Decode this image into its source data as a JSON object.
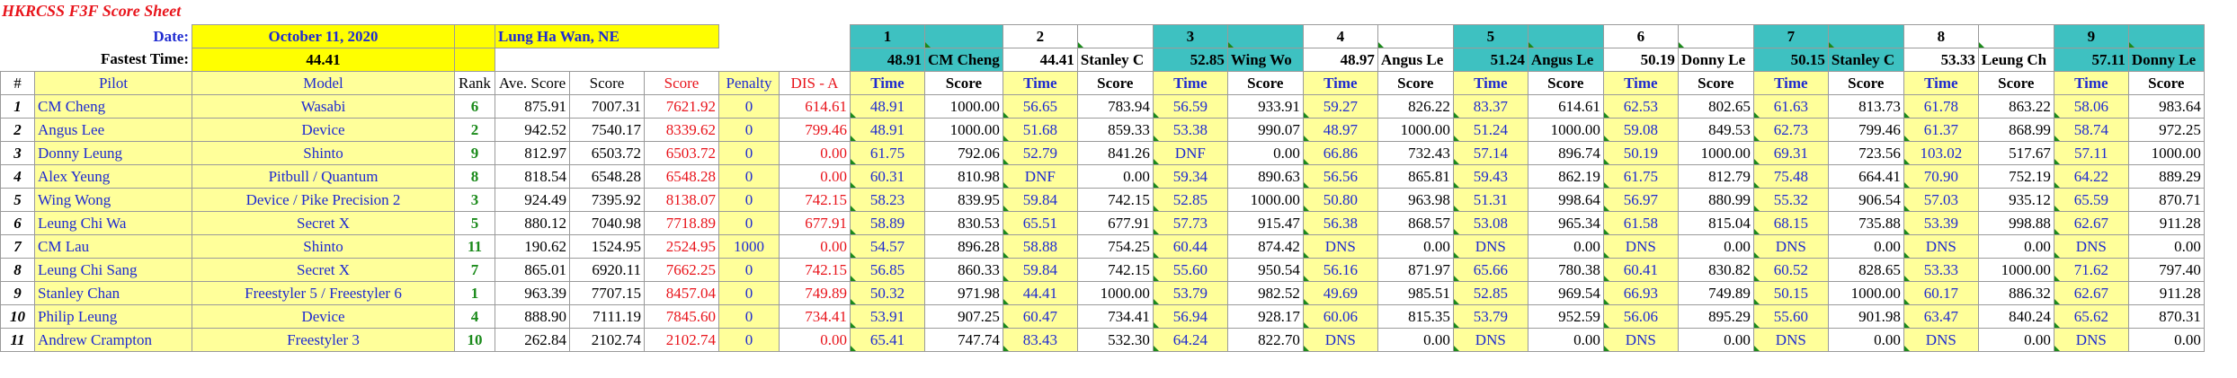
{
  "title": "HKRCSS F3F Score Sheet",
  "date_label": "Date:",
  "date_value": "October 11, 2020",
  "location": "Lung Ha Wan, NE",
  "fastest_label": "Fastest Time:",
  "fastest_value": "44.41",
  "rounds": [
    {
      "num": "1",
      "best_time": "48.91",
      "best_pilot": "CM Cheng"
    },
    {
      "num": "2",
      "best_time": "44.41",
      "best_pilot": "Stanley C"
    },
    {
      "num": "3",
      "best_time": "52.85",
      "best_pilot": "Wing Wo"
    },
    {
      "num": "4",
      "best_time": "48.97",
      "best_pilot": "Angus Le"
    },
    {
      "num": "5",
      "best_time": "51.24",
      "best_pilot": "Angus Le"
    },
    {
      "num": "6",
      "best_time": "50.19",
      "best_pilot": "Donny Le"
    },
    {
      "num": "7",
      "best_time": "50.15",
      "best_pilot": "Stanley C"
    },
    {
      "num": "8",
      "best_time": "53.33",
      "best_pilot": "Leung Ch"
    },
    {
      "num": "9",
      "best_time": "57.11",
      "best_pilot": "Donny Le"
    }
  ],
  "headers": {
    "num": "#",
    "pilot": "Pilot",
    "model": "Model",
    "rank": "Rank",
    "ave": "Ave. Score",
    "score": "Score",
    "score2": "Score",
    "penalty": "Penalty",
    "dis": "DIS - A",
    "time": "Time",
    "round_score": "Score"
  },
  "pilots": [
    {
      "n": "1",
      "pilot": "CM Cheng",
      "model": "Wasabi",
      "rank": "6",
      "ave": "875.91",
      "score": "7007.31",
      "score2": "7621.92",
      "penalty": "0",
      "dis": "614.61",
      "rounds": [
        [
          "48.91",
          "1000.00"
        ],
        [
          "56.65",
          "783.94"
        ],
        [
          "56.59",
          "933.91"
        ],
        [
          "59.27",
          "826.22"
        ],
        [
          "83.37",
          "614.61"
        ],
        [
          "62.53",
          "802.65"
        ],
        [
          "61.63",
          "813.73"
        ],
        [
          "61.78",
          "863.22"
        ],
        [
          "58.06",
          "983.64"
        ]
      ]
    },
    {
      "n": "2",
      "pilot": "Angus Lee",
      "model": "Device",
      "rank": "2",
      "ave": "942.52",
      "score": "7540.17",
      "score2": "8339.62",
      "penalty": "0",
      "dis": "799.46",
      "rounds": [
        [
          "48.91",
          "1000.00"
        ],
        [
          "51.68",
          "859.33"
        ],
        [
          "53.38",
          "990.07"
        ],
        [
          "48.97",
          "1000.00"
        ],
        [
          "51.24",
          "1000.00"
        ],
        [
          "59.08",
          "849.53"
        ],
        [
          "62.73",
          "799.46"
        ],
        [
          "61.37",
          "868.99"
        ],
        [
          "58.74",
          "972.25"
        ]
      ]
    },
    {
      "n": "3",
      "pilot": "Donny Leung",
      "model": "Shinto",
      "rank": "9",
      "ave": "812.97",
      "score": "6503.72",
      "score2": "6503.72",
      "penalty": "0",
      "dis": "0.00",
      "rounds": [
        [
          "61.75",
          "792.06"
        ],
        [
          "52.79",
          "841.26"
        ],
        [
          "DNF",
          "0.00"
        ],
        [
          "66.86",
          "732.43"
        ],
        [
          "57.14",
          "896.74"
        ],
        [
          "50.19",
          "1000.00"
        ],
        [
          "69.31",
          "723.56"
        ],
        [
          "103.02",
          "517.67"
        ],
        [
          "57.11",
          "1000.00"
        ]
      ]
    },
    {
      "n": "4",
      "pilot": "Alex Yeung",
      "model": "Pitbull / Quantum",
      "rank": "8",
      "ave": "818.54",
      "score": "6548.28",
      "score2": "6548.28",
      "penalty": "0",
      "dis": "0.00",
      "rounds": [
        [
          "60.31",
          "810.98"
        ],
        [
          "DNF",
          "0.00"
        ],
        [
          "59.34",
          "890.63"
        ],
        [
          "56.56",
          "865.81"
        ],
        [
          "59.43",
          "862.19"
        ],
        [
          "61.75",
          "812.79"
        ],
        [
          "75.48",
          "664.41"
        ],
        [
          "70.90",
          "752.19"
        ],
        [
          "64.22",
          "889.29"
        ]
      ]
    },
    {
      "n": "5",
      "pilot": "Wing Wong",
      "model": "Device / Pike Precision 2",
      "rank": "3",
      "ave": "924.49",
      "score": "7395.92",
      "score2": "8138.07",
      "penalty": "0",
      "dis": "742.15",
      "rounds": [
        [
          "58.23",
          "839.95"
        ],
        [
          "59.84",
          "742.15"
        ],
        [
          "52.85",
          "1000.00"
        ],
        [
          "50.80",
          "963.98"
        ],
        [
          "51.31",
          "998.64"
        ],
        [
          "56.97",
          "880.99"
        ],
        [
          "55.32",
          "906.54"
        ],
        [
          "57.03",
          "935.12"
        ],
        [
          "65.59",
          "870.71"
        ]
      ]
    },
    {
      "n": "6",
      "pilot": "Leung Chi Wa",
      "model": "Secret X",
      "rank": "5",
      "ave": "880.12",
      "score": "7040.98",
      "score2": "7718.89",
      "penalty": "0",
      "dis": "677.91",
      "rounds": [
        [
          "58.89",
          "830.53"
        ],
        [
          "65.51",
          "677.91"
        ],
        [
          "57.73",
          "915.47"
        ],
        [
          "56.38",
          "868.57"
        ],
        [
          "53.08",
          "965.34"
        ],
        [
          "61.58",
          "815.04"
        ],
        [
          "68.15",
          "735.88"
        ],
        [
          "53.39",
          "998.88"
        ],
        [
          "62.67",
          "911.28"
        ]
      ]
    },
    {
      "n": "7",
      "pilot": "CM Lau",
      "model": "Shinto",
      "rank": "11",
      "ave": "190.62",
      "score": "1524.95",
      "score2": "2524.95",
      "penalty": "1000",
      "dis": "0.00",
      "rounds": [
        [
          "54.57",
          "896.28"
        ],
        [
          "58.88",
          "754.25"
        ],
        [
          "60.44",
          "874.42"
        ],
        [
          "DNS",
          "0.00"
        ],
        [
          "DNS",
          "0.00"
        ],
        [
          "DNS",
          "0.00"
        ],
        [
          "DNS",
          "0.00"
        ],
        [
          "DNS",
          "0.00"
        ],
        [
          "DNS",
          "0.00"
        ]
      ]
    },
    {
      "n": "8",
      "pilot": "Leung Chi Sang",
      "model": "Secret X",
      "rank": "7",
      "ave": "865.01",
      "score": "6920.11",
      "score2": "7662.25",
      "penalty": "0",
      "dis": "742.15",
      "rounds": [
        [
          "56.85",
          "860.33"
        ],
        [
          "59.84",
          "742.15"
        ],
        [
          "55.60",
          "950.54"
        ],
        [
          "56.16",
          "871.97"
        ],
        [
          "65.66",
          "780.38"
        ],
        [
          "60.41",
          "830.82"
        ],
        [
          "60.52",
          "828.65"
        ],
        [
          "53.33",
          "1000.00"
        ],
        [
          "71.62",
          "797.40"
        ]
      ]
    },
    {
      "n": "9",
      "pilot": "Stanley Chan",
      "model": "Freestyler 5 / Freestyler 6",
      "rank": "1",
      "ave": "963.39",
      "score": "7707.15",
      "score2": "8457.04",
      "penalty": "0",
      "dis": "749.89",
      "rounds": [
        [
          "50.32",
          "971.98"
        ],
        [
          "44.41",
          "1000.00"
        ],
        [
          "53.79",
          "982.52"
        ],
        [
          "49.69",
          "985.51"
        ],
        [
          "52.85",
          "969.54"
        ],
        [
          "66.93",
          "749.89"
        ],
        [
          "50.15",
          "1000.00"
        ],
        [
          "60.17",
          "886.32"
        ],
        [
          "62.67",
          "911.28"
        ]
      ]
    },
    {
      "n": "10",
      "pilot": "Philip Leung",
      "model": "Device",
      "rank": "4",
      "ave": "888.90",
      "score": "7111.19",
      "score2": "7845.60",
      "penalty": "0",
      "dis": "734.41",
      "rounds": [
        [
          "53.91",
          "907.25"
        ],
        [
          "60.47",
          "734.41"
        ],
        [
          "56.94",
          "928.17"
        ],
        [
          "60.06",
          "815.35"
        ],
        [
          "53.79",
          "952.59"
        ],
        [
          "56.06",
          "895.29"
        ],
        [
          "55.60",
          "901.98"
        ],
        [
          "63.47",
          "840.24"
        ],
        [
          "65.62",
          "870.31"
        ]
      ]
    },
    {
      "n": "11",
      "pilot": "Andrew Crampton",
      "model": "Freestyler 3",
      "rank": "10",
      "ave": "262.84",
      "score": "2102.74",
      "score2": "2102.74",
      "penalty": "0",
      "dis": "0.00",
      "rounds": [
        [
          "65.41",
          "747.74"
        ],
        [
          "83.43",
          "532.30"
        ],
        [
          "64.24",
          "822.70"
        ],
        [
          "DNS",
          "0.00"
        ],
        [
          "DNS",
          "0.00"
        ],
        [
          "DNS",
          "0.00"
        ],
        [
          "DNS",
          "0.00"
        ],
        [
          "DNS",
          "0.00"
        ],
        [
          "DNS",
          "0.00"
        ]
      ]
    }
  ]
}
